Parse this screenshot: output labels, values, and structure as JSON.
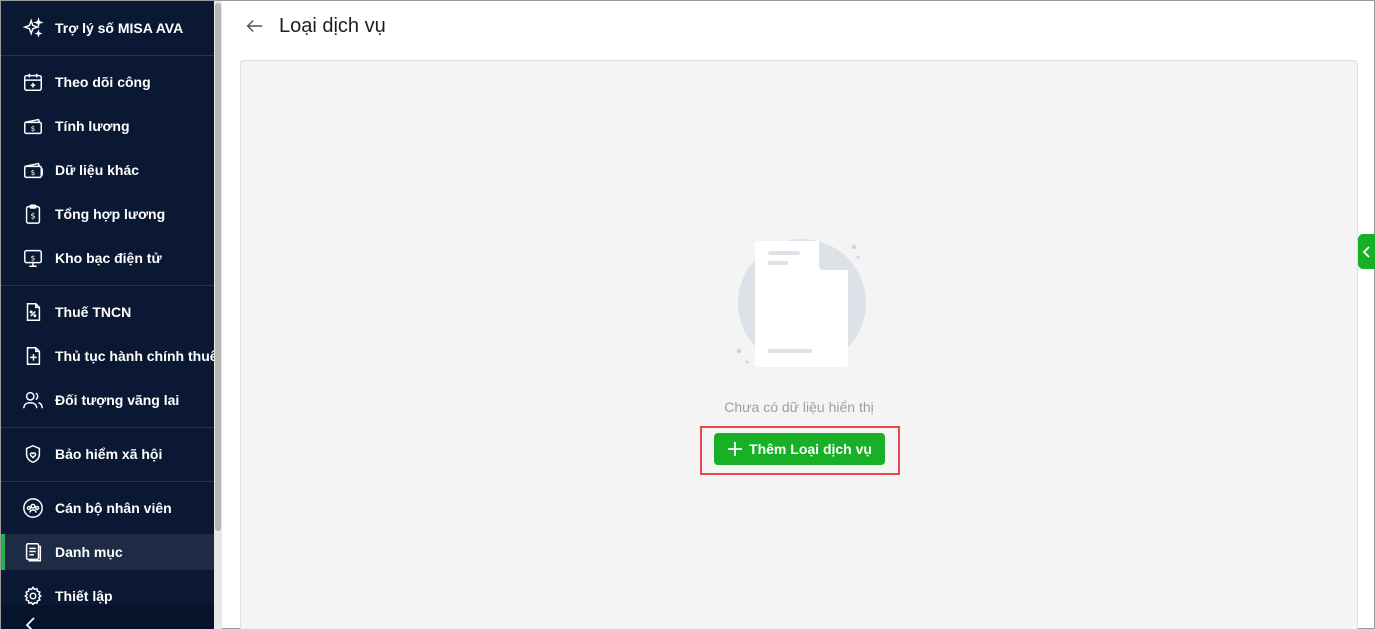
{
  "sidebar": {
    "items": [
      {
        "label": "Trợ lý số MISA AVA",
        "icon": "sparkle-icon"
      },
      {
        "label": "Theo dõi công",
        "icon": "calendar-plus-icon"
      },
      {
        "label": "Tính lương",
        "icon": "money-icon"
      },
      {
        "label": "Dữ liệu khác",
        "icon": "money-stack-icon"
      },
      {
        "label": "Tổng hợp lương",
        "icon": "clipboard-dollar-icon"
      },
      {
        "label": "Kho bạc điện tử",
        "icon": "monitor-dollar-icon"
      },
      {
        "label": "Thuế TNCN",
        "icon": "tax-document-icon"
      },
      {
        "label": "Thủ tục hành chính thuế",
        "icon": "document-plus-icon"
      },
      {
        "label": "Đối tượng vãng lai",
        "icon": "users-icon"
      },
      {
        "label": "Bảo hiểm xã hội",
        "icon": "shield-heart-icon"
      },
      {
        "label": "Cán bộ nhân viên",
        "icon": "team-circle-icon"
      },
      {
        "label": "Danh mục",
        "icon": "catalog-icon",
        "active": true
      },
      {
        "label": "Thiết lập",
        "icon": "gear-icon"
      }
    ]
  },
  "header": {
    "back_icon": "arrow-left-icon",
    "title": "Loại dịch vụ"
  },
  "main": {
    "empty_text": "Chưa có dữ liệu hiển thị",
    "add_button_label": "Thêm Loại dịch vụ",
    "highlight_color": "#e5484d"
  },
  "colors": {
    "sidebar_bg": "#0a1833",
    "accent_green": "#17b026",
    "active_bar": "#27b34a"
  }
}
